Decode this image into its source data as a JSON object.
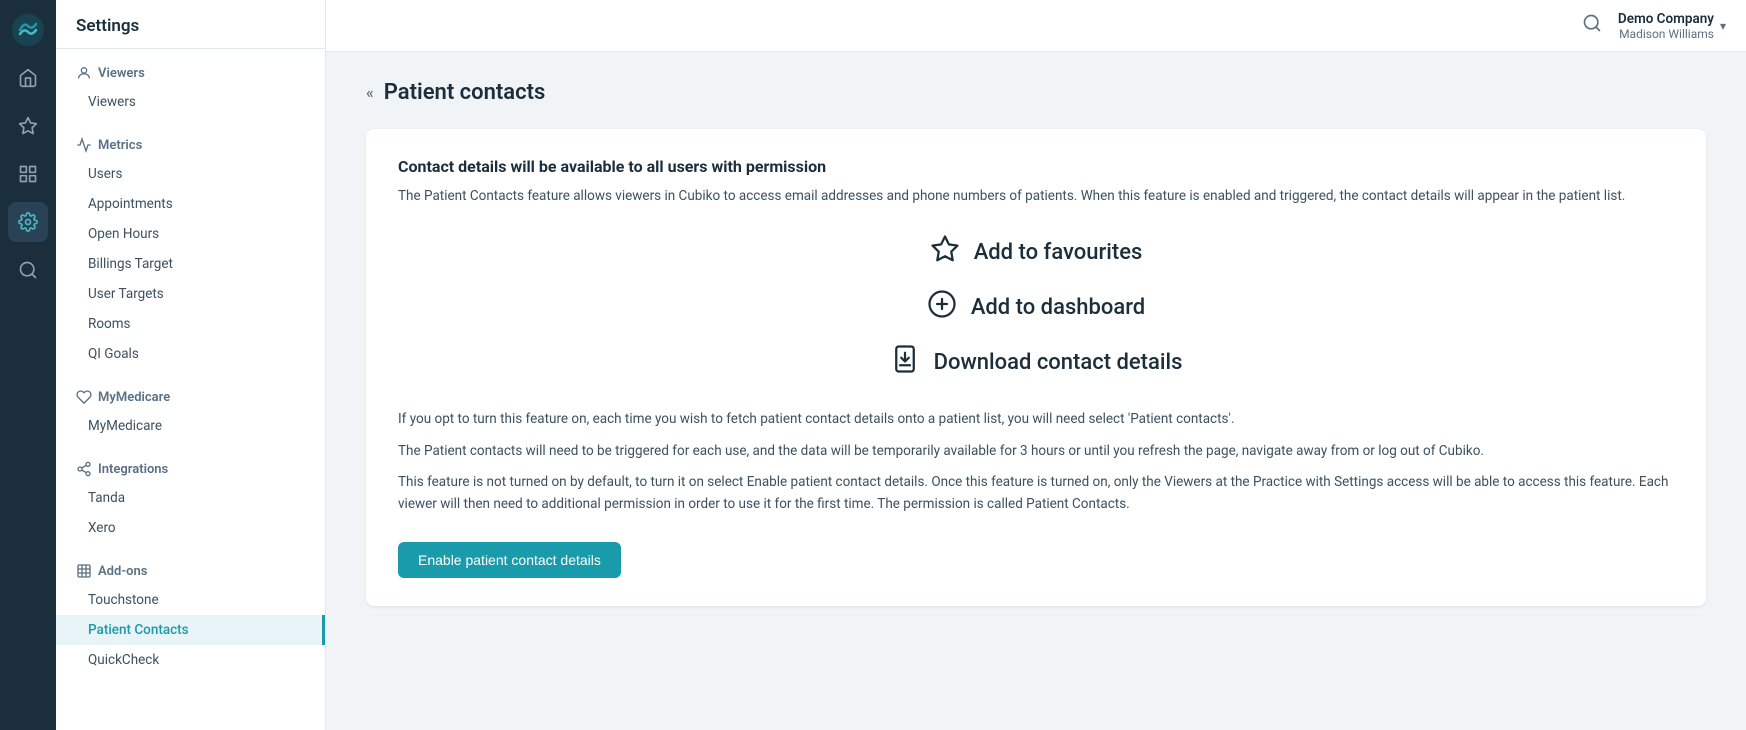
{
  "app": {
    "title": "Settings"
  },
  "topbar": {
    "company": "Demo Company",
    "user": "Madison Williams",
    "chevron": "▾"
  },
  "sidebar": {
    "header": "Settings",
    "sections": [
      {
        "id": "viewers",
        "title": "Viewers",
        "icon": "person",
        "items": [
          "Viewers"
        ]
      },
      {
        "id": "metrics",
        "title": "Metrics",
        "icon": "chart",
        "items": [
          "Users",
          "Appointments",
          "Open Hours",
          "Billings Target",
          "User Targets",
          "Rooms",
          "QI Goals"
        ]
      },
      {
        "id": "mymedicare",
        "title": "MyMedicare",
        "icon": "heart",
        "items": [
          "MyMedicare"
        ]
      },
      {
        "id": "integrations",
        "title": "Integrations",
        "icon": "plug",
        "items": [
          "Tanda",
          "Xero"
        ]
      },
      {
        "id": "addons",
        "title": "Add-ons",
        "icon": "addons",
        "items": [
          "Touchstone",
          "Patient Contacts",
          "QuickCheck"
        ]
      }
    ],
    "active_item": "Patient Contacts"
  },
  "page": {
    "collapse_btn": "«",
    "title": "Patient contacts",
    "card": {
      "heading": "Contact details will be available to all users with permission",
      "description": "The Patient Contacts feature allows viewers in Cubiko to access email addresses and phone numbers of patients. When this feature is enabled and triggered, the contact details will appear in the patient list.",
      "features": [
        {
          "icon": "☆",
          "label": "Add to favourites"
        },
        {
          "icon": "⊕",
          "label": "Add to dashboard"
        },
        {
          "icon": "📲",
          "label": "Download contact details"
        }
      ],
      "info1": "If you opt to turn this feature on, each time you wish to fetch patient contact details onto a patient list, you will need select 'Patient contacts'.",
      "info2": "The Patient contacts will need to be triggered for each use, and the data will be temporarily available for 3 hours or until you refresh the page, navigate away from or log out of Cubiko.",
      "info3": "This feature is not turned on by default, to turn it on select Enable patient contact details. Once this feature is turned on, only the Viewers at the Practice with Settings access will be able to access this feature. Each viewer will then need to additional permission in order to use it for the first time. The permission is called Patient Contacts.",
      "enable_button": "Enable patient contact details"
    }
  },
  "nav_icons": [
    {
      "id": "home",
      "symbol": "⌂",
      "active": false
    },
    {
      "id": "star",
      "symbol": "★",
      "active": false
    },
    {
      "id": "grid",
      "symbol": "⊞",
      "active": false
    },
    {
      "id": "settings",
      "symbol": "⚙",
      "active": true
    },
    {
      "id": "search",
      "symbol": "⌕",
      "active": false
    }
  ]
}
